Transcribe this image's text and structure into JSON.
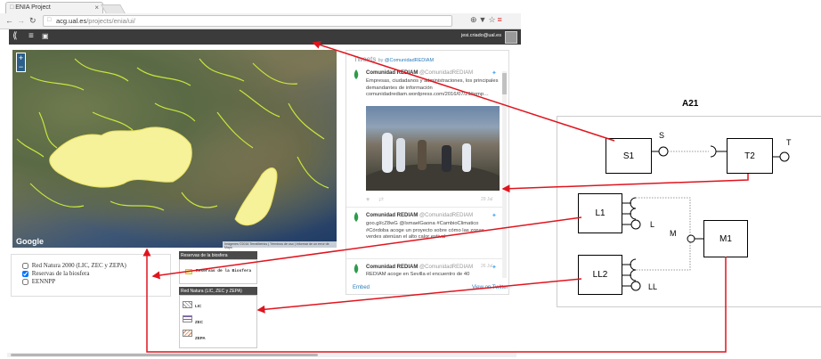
{
  "browser": {
    "tab_title": "ENIA Project",
    "url_domain": "acg.ual.es",
    "url_path": "/projects/enia/ui/"
  },
  "app": {
    "user": "jesi.criado@ual.es"
  },
  "map": {
    "zoom_in": "+",
    "zoom_out": "−",
    "logo": "Google",
    "attribution": "Imágenes ©2016 TerraMetrics | Términos de uso | Informar de un error de Maps"
  },
  "tweets": {
    "title": "Tweets",
    "by": "by",
    "handle": "@ComunidadREDIAM",
    "items": [
      {
        "name": "Comunidad REDIAM",
        "handle": "@ComunidadREDIAM",
        "text": "Empresas, ciudadanos y administraciones, los principales demandantes de información comunidadrediam.wordpress.com/2016/07/29/temp…",
        "time": "29 Jul"
      },
      {
        "name": "Comunidad REDIAM",
        "handle": "@ComunidadREDIAM",
        "text": "goo.gl/cZ8wG @IsmaelGaona #CambioClimatico #Córdoba acoge un proyecto sobre cómo las zonas verdes atenúan el alto calor estival"
      },
      {
        "name": "Comunidad REDIAM",
        "handle": "@ComunidadREDIAM",
        "text": "REDIAM acoge en Sevilla el encuentro de 40",
        "time": "26 Jul"
      }
    ],
    "embed": "Embed",
    "view_on": "View on Twitter"
  },
  "layers": {
    "items": [
      {
        "label": "Red Natura 2000 (LIC, ZEC y ZEPA)",
        "checked": false
      },
      {
        "label": "Reservas de la biosfera",
        "checked": true
      },
      {
        "label": "EENNPP",
        "checked": false
      }
    ]
  },
  "legend": {
    "biosfera_header": "Reservas de la biosfera",
    "biosfera_item": "Reservas de la Biosfera",
    "natura_header": "Red Natura (LIC, ZEC y ZEPA)",
    "natura_items": [
      "LIC",
      "ZEC",
      "ZEPA"
    ]
  },
  "diagram": {
    "title": "A21",
    "nodes": {
      "s1": "S1",
      "t2": "T2",
      "l1": "L1",
      "ll2": "LL2",
      "m1": "M1"
    },
    "ports": {
      "s": "S",
      "t": "T",
      "l": "L",
      "ll": "LL",
      "m": "M"
    },
    "colors": {
      "arrow": "#e0141e",
      "stroke": "#000000"
    }
  }
}
